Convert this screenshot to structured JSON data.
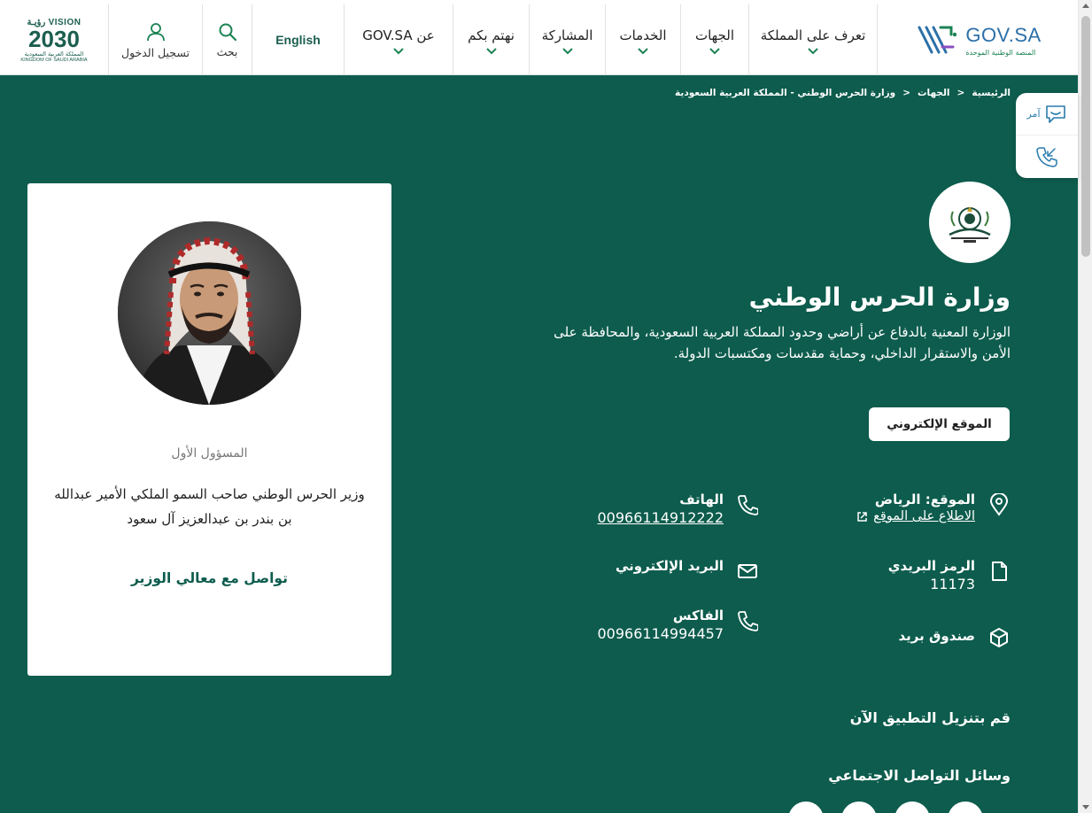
{
  "header": {
    "logo": {
      "brand": "GOV.SA",
      "tagline": "المنصة الوطنية الموحدة"
    },
    "nav": [
      {
        "label": "تعرف على المملكة"
      },
      {
        "label": "الجهات"
      },
      {
        "label": "الخدمات"
      },
      {
        "label": "المشاركة"
      },
      {
        "label": "نهتم بكم"
      },
      {
        "label": "عن GOV.SA"
      }
    ],
    "language": "English",
    "search_label": "بحث",
    "login_label": "تسجيل الدخول",
    "vision": {
      "top": "VISION رؤيـة",
      "year": "2030",
      "ar": "المملكة العربية السعودية",
      "en": "KINGDOM OF SAUDI ARABIA"
    }
  },
  "breadcrumb": [
    "الرئيسية",
    "الجهات",
    "وزارة الحرس الوطني - المملكة العربية السعودية"
  ],
  "floating": {
    "chat_label": "آمر"
  },
  "minister": {
    "role": "المسؤول الأول",
    "name": "وزير الحرس الوطني صاحب السمو الملكي الأمير عبدالله بن بندر بن عبدالعزيز آل سعود",
    "contact_label": "تواصل مع معالي الوزير"
  },
  "org": {
    "title": "وزارة الحرس الوطني",
    "description": "الوزارة المعنية بالدفاع عن أراضي وحدود المملكة العربية السعودية، والمحافظة على الأمن والاستقرار الداخلي، وحماية مقدسات ومكتسبات الدولة.",
    "website_label": "الموقع الإلكتروني"
  },
  "info": {
    "location_label": "الموقع: الرياض",
    "map_link": "الاطلاع على الموقع",
    "phone_label": "الهاتف",
    "phone_value": "00966114912222",
    "postal_label": "الرمز البريدي",
    "postal_value": "11173",
    "email_label": "البريد الإلكتروني",
    "pobox_label": "صندوق بريد",
    "fax_label": "الفاكس",
    "fax_value": "00966114994457"
  },
  "sections": {
    "download_app": "قم بتنزيل التطبيق الآن",
    "social": "وسائل التواصل الاجتماعي"
  },
  "colors": {
    "primary": "#0d5c4d",
    "accent": "#1b8354",
    "link_blue": "#2a7cae"
  }
}
